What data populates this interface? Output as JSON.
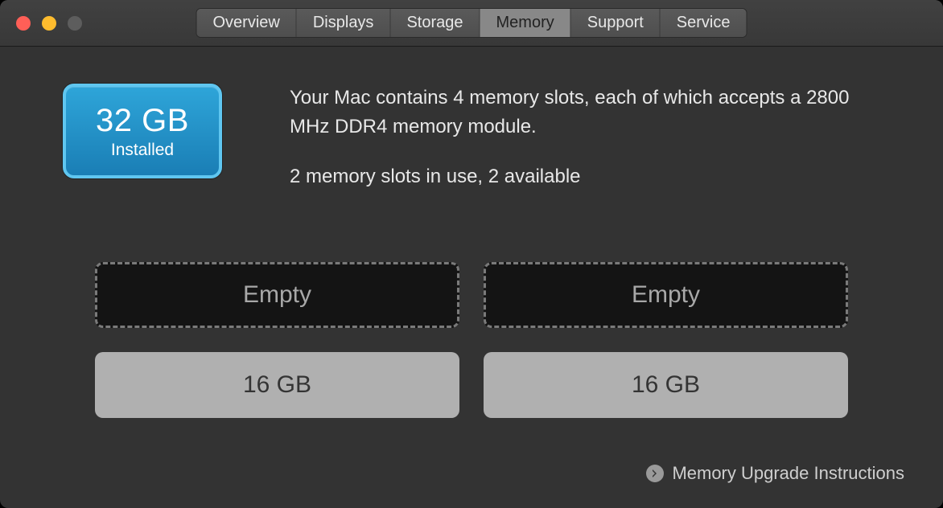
{
  "tabs": {
    "overview": "Overview",
    "displays": "Displays",
    "storage": "Storage",
    "memory": "Memory",
    "support": "Support",
    "service": "Service"
  },
  "installed": {
    "size": "32 GB",
    "label": "Installed"
  },
  "description": {
    "line1": "Your Mac contains 4 memory slots, each of which accepts a 2800 MHz DDR4 memory module.",
    "line2": "2 memory slots in use, 2 available"
  },
  "slots": {
    "slot0": "Empty",
    "slot1": "Empty",
    "slot2": "16 GB",
    "slot3": "16 GB"
  },
  "footer": {
    "upgrade_link": "Memory Upgrade Instructions"
  }
}
